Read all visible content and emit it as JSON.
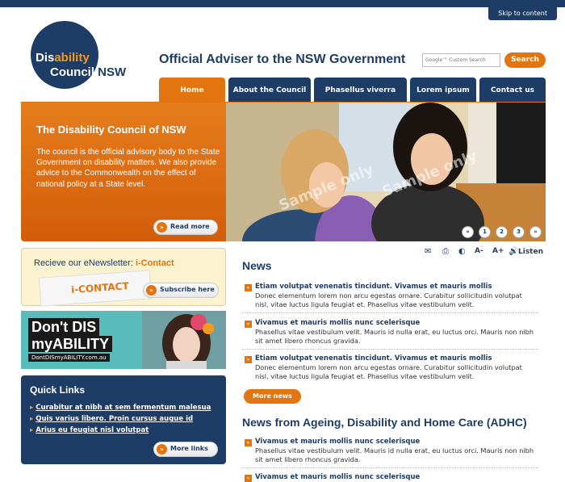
{
  "skip_link": "Skip to content",
  "logo": {
    "line1a": "Dis",
    "line1b": "ability",
    "line2a": "Council ",
    "line2b": "NSW"
  },
  "site_title": "Official Adviser to the NSW Government",
  "search": {
    "placeholder": "Google™ Custom Search",
    "button": "Search"
  },
  "nav": [
    "Home",
    "About the Council",
    "Phasellus viverra",
    "Lorem ipsum",
    "Contact us"
  ],
  "hero": {
    "title": "The Disability Council of NSW",
    "body": "The council is the official advisory body to the State Government on disability matters. We also provide advice to the Commonwealth on the effect of national policy at a State level.",
    "read_more": "Read more",
    "watermark": "Sample only",
    "pages": [
      "«",
      "1",
      "2",
      "3",
      "»"
    ]
  },
  "enewsletter": {
    "prefix": "Recieve our eNewsletter: ",
    "name": "i-Contact",
    "thumb_label": "i-CONTACT",
    "button": "Subscribe here"
  },
  "banner": {
    "line1": "Don't DIS",
    "line2": "myABILITY",
    "url": "DontDISmyABILITY.com.au"
  },
  "quick_links": {
    "title": "Quick Links",
    "items": [
      "Curabitur at nibh at sem fermentum malesua",
      "Quis varius libero. Proin cursus augue id",
      "Arius eu feugiat nisl volutpat"
    ],
    "button": "More links"
  },
  "tools": {
    "listen": "Listen",
    "icons": [
      "email-icon",
      "print-icon",
      "contrast-icon",
      "text-smaller-icon",
      "text-larger-icon",
      "listen-icon"
    ],
    "smaller": "A-",
    "larger": "A+"
  },
  "news": {
    "title": "News",
    "items": [
      {
        "title": "Etiam volutpat venenatis tincidunt. Vivamus et mauris mollis",
        "body": "Donec elementum lorem non arcu egestas ornare. Curabitur sollicitudin volutpat nisl, vitae luctus ligula feugiat et. Phasellus vitae vestibulum velit."
      },
      {
        "title": "Vivamus et mauris mollis nunc scelerisque",
        "body": "Phasellus vitae vestibulum velit. Mauris id nulla erat, eu luctus orci. Mauris non nibh sit amet libero rhoncus gravida."
      },
      {
        "title": "Etiam volutpat venenatis tincidunt. Vivamus et mauris mollis",
        "body": "Donec elementum lorem non arcu egestas ornare. Curabitur sollicitudin volutpat nisl, vitae luctus ligula feugiat et. Phasellus vitae vestibulum velit."
      }
    ],
    "more": "More news"
  },
  "adhc": {
    "title": "News from Ageing, Disability and Home Care (ADHC)",
    "items": [
      {
        "title": "Vivamus et mauris mollis nunc scelerisque",
        "body": "Phasellus vitae vestibulum velit. Mauris id nulla erat, eu luctus orci. Mauris non nibh sit amet libero rhoncus gravida."
      },
      {
        "title": "Vivamus et mauris mollis nunc scelerisque",
        "body": ""
      }
    ]
  },
  "colors": {
    "navy": "#1e3d66",
    "orange": "#e2750f",
    "teal": "#5abbbb",
    "cream": "#fbf2cf"
  }
}
